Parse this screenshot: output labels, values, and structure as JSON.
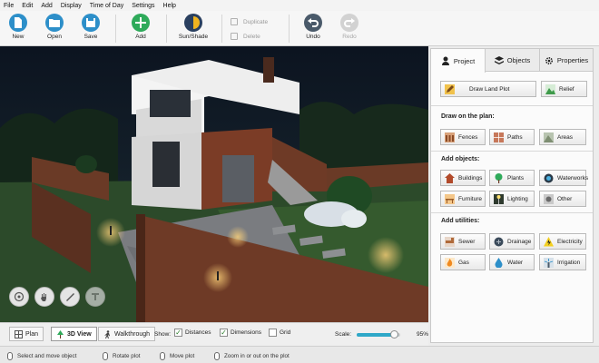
{
  "menu": [
    "File",
    "Edit",
    "Add",
    "Display",
    "Time of Day",
    "Settings",
    "Help"
  ],
  "toolbar": {
    "new": "New",
    "open": "Open",
    "save": "Save",
    "add": "Add",
    "sun_shade": "Sun/Shade",
    "duplicate": "Duplicate",
    "delete": "Delete",
    "undo": "Undo",
    "redo": "Redo"
  },
  "view_tabs": {
    "plan": "Plan",
    "view3d": "3D View",
    "walkthrough": "Walkthrough"
  },
  "show": {
    "label": "Show:",
    "distances": "Distances",
    "dimensions": "Dimensions",
    "grid": "Grid",
    "distances_checked": true,
    "dimensions_checked": true,
    "grid_checked": false
  },
  "scale": {
    "label": "Scale:",
    "value_text": "95%",
    "fraction": 0.95
  },
  "status_hints": [
    "Select and move object",
    "Rotate plot",
    "Move plot",
    "Zoom in or out on the plot"
  ],
  "panel": {
    "tabs": [
      "Project",
      "Objects",
      "Properties"
    ],
    "active_tab": "Project",
    "draw_land_plot": "Draw Land Plot",
    "relief": "Relief",
    "draw_on_plan": {
      "title": "Draw on the plan:",
      "items": [
        "Fences",
        "Paths",
        "Areas"
      ]
    },
    "add_objects": {
      "title": "Add objects:",
      "items": [
        "Buildings",
        "Plants",
        "Waterworks",
        "Furniture",
        "Lighting",
        "Other"
      ]
    },
    "add_utilities": {
      "title": "Add utilities:",
      "items": [
        "Sewer",
        "Drainage",
        "Electricity",
        "Gas",
        "Water",
        "Irrigation"
      ]
    }
  },
  "colors": {
    "accent_blue": "#2d8fc9",
    "add_green": "#2eaa5a",
    "undo_dark": "#4a5a6a",
    "sun_yellow": "#f0b420",
    "panel_bg": "#fbfbfb"
  }
}
